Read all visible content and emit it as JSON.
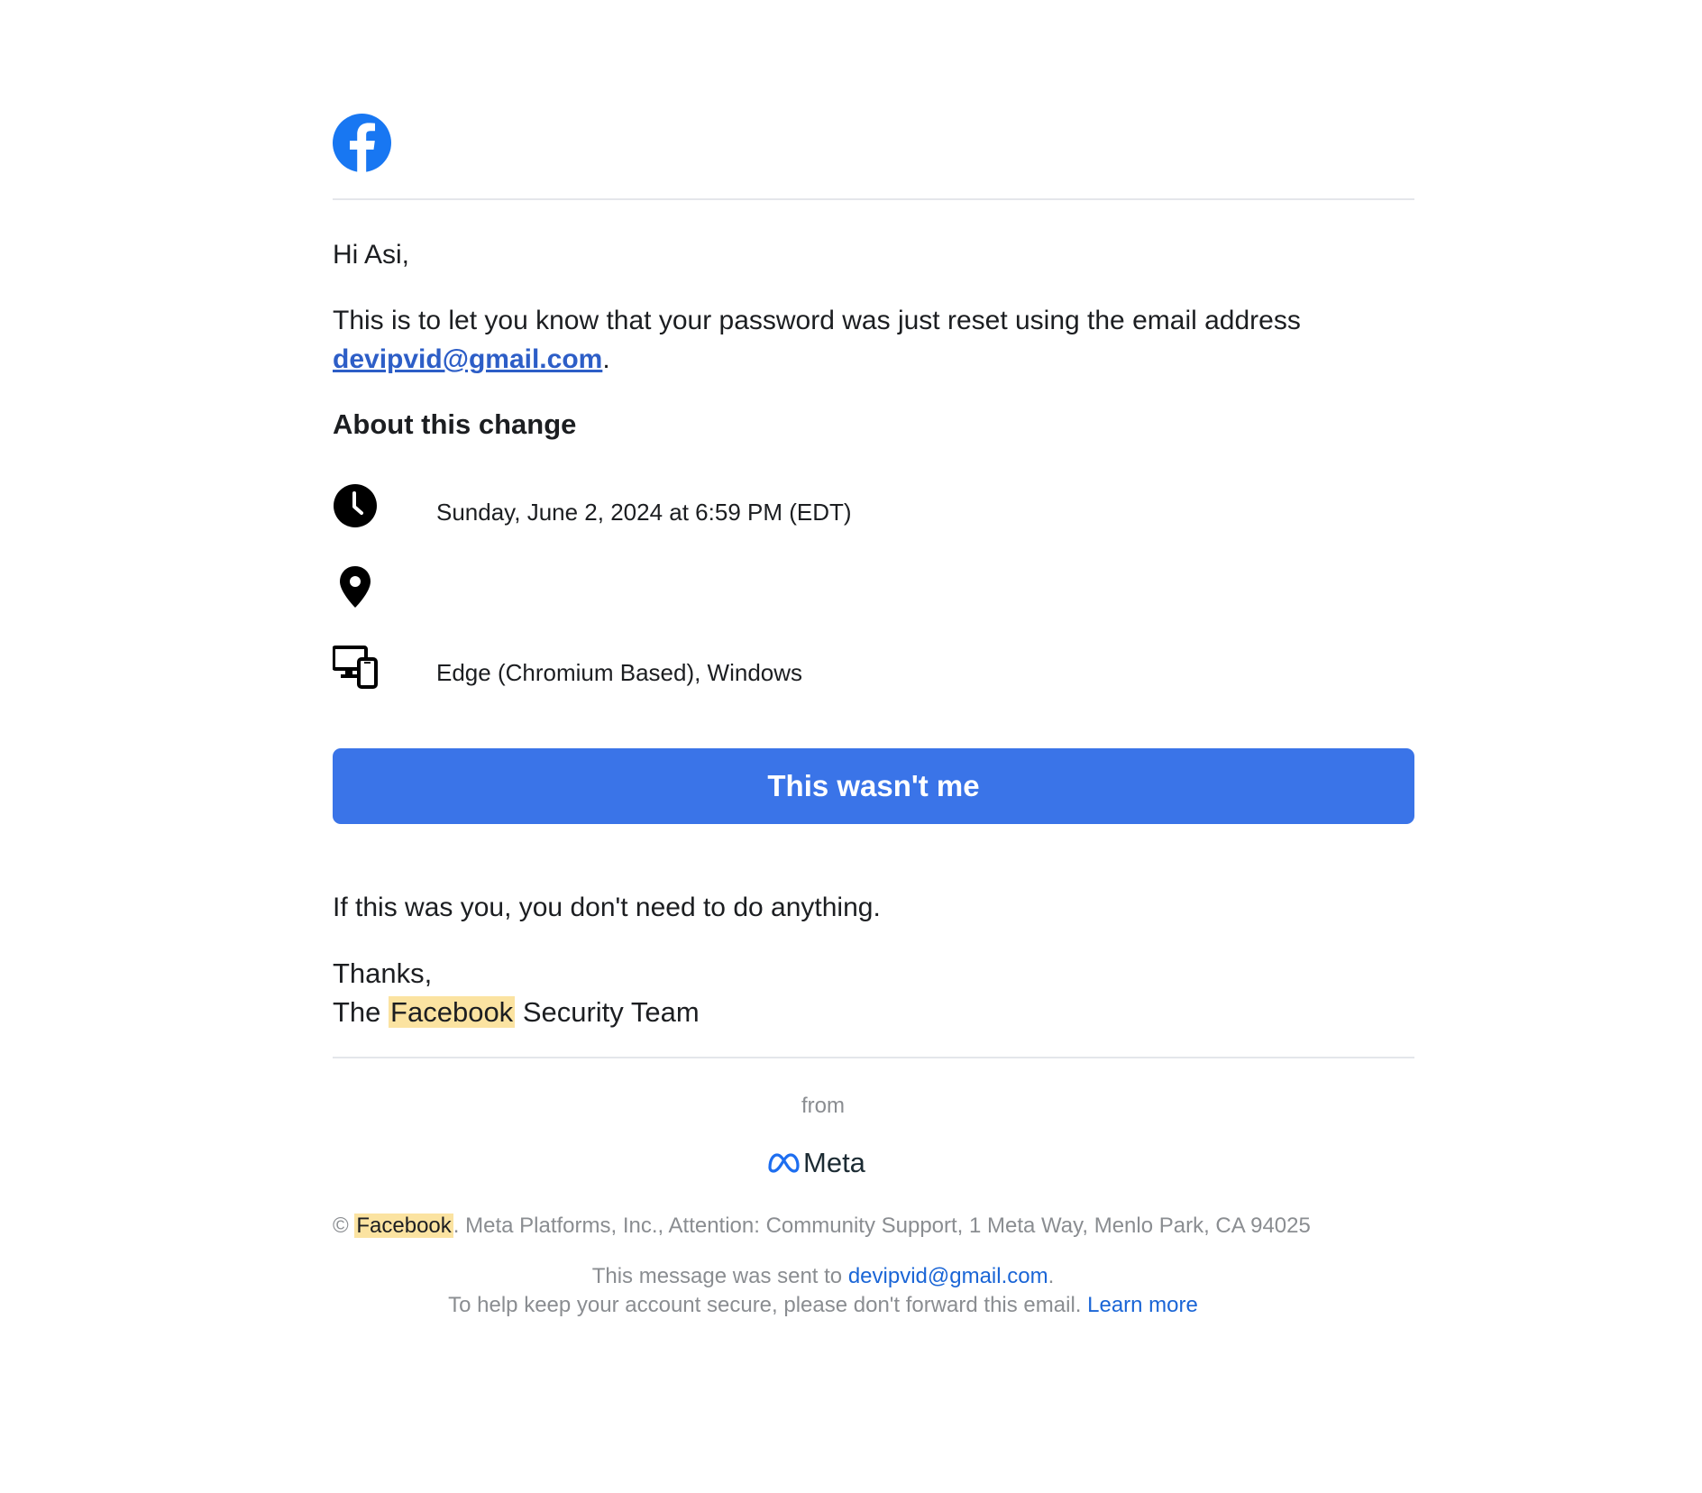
{
  "colors": {
    "facebook_blue": "#1877f2",
    "button_blue": "#3a74e8",
    "link_blue": "#2d5ec7",
    "highlight": "#fbe3a1",
    "muted_text": "#8a8d91"
  },
  "header": {
    "logo_icon": "facebook-logo-icon"
  },
  "body": {
    "greeting": "Hi Asi,",
    "intro_text": "This is to let you know that your password was just reset using the email address",
    "intro_email": "devipvid@gmail.com",
    "intro_period": ".",
    "section_title": "About this change",
    "details": {
      "time_icon": "clock-icon",
      "time": "Sunday, June 2, 2024 at 6:59 PM (EDT)",
      "location_icon": "location-pin-icon",
      "location": "",
      "device_icon": "devices-icon",
      "device": "Edge (Chromium Based), Windows"
    },
    "button_label": "This wasn't me",
    "closing": "If this was you, you don't need to do anything.",
    "thanks": "Thanks,",
    "signoff_prefix": "The",
    "signoff_brand": "Facebook",
    "signoff_suffix": "Security Team"
  },
  "footer": {
    "from_label": "from",
    "meta_logo_icon": "meta-logo-icon",
    "meta_word": "Meta",
    "copyright_symbol": "©",
    "copyright_brand": "Facebook",
    "copyright_text": ". Meta Platforms, Inc., Attention: Community Support, 1 Meta Way, Menlo Park, CA 94025",
    "sent_prefix": "This message was sent to",
    "sent_email": "devipvid@gmail.com",
    "sent_suffix": ".",
    "secure_text": "To help keep your account secure, please don't forward this email.",
    "learn_more": "Learn more"
  }
}
